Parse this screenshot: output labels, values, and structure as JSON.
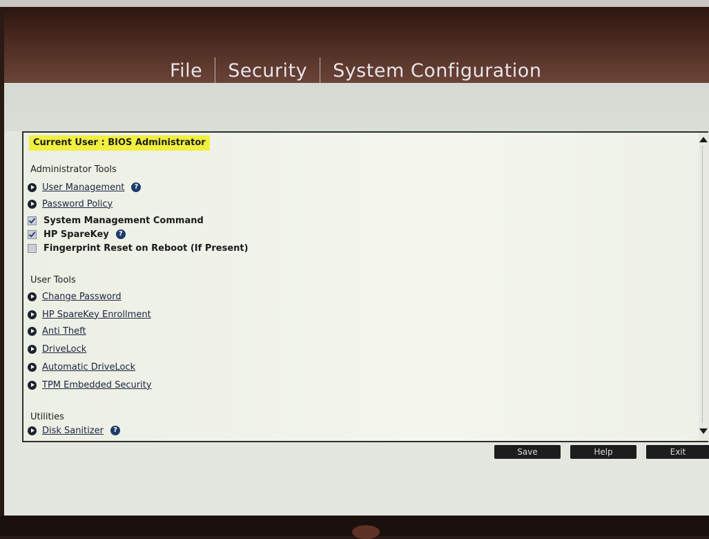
{
  "menu": {
    "items": [
      "File",
      "Security",
      "System Configuration"
    ]
  },
  "header": {
    "current_user": "Current User : BIOS Administrator"
  },
  "admin_tools": {
    "title": "Administrator Tools",
    "user_management": "User Management",
    "password_policy": "Password Policy",
    "system_management_command": "System Management Command",
    "hp_sparekey": "HP SpareKey",
    "fingerprint_reset": "Fingerprint Reset on Reboot (If Present)"
  },
  "user_tools": {
    "title": "User Tools",
    "change_password": "Change Password",
    "sparekey_enrollment": "HP SpareKey Enrollment",
    "anti_theft": "Anti Theft",
    "drivelock": "DriveLock",
    "automatic_drivelock": "Automatic DriveLock",
    "tpm": "TPM Embedded Security"
  },
  "utilities": {
    "title": "Utilities",
    "disk_sanitizer": "Disk Sanitizer"
  },
  "buttons": {
    "save": "Save",
    "help": "Help",
    "exit": "Exit"
  },
  "checkboxes": {
    "system_management_command": true,
    "hp_sparekey": true,
    "fingerprint_reset": false
  },
  "colors": {
    "highlight": "#f1ef3f",
    "menubar": "#3b2018",
    "panel": "#f0f3ea"
  },
  "icons": [
    "chevron-right-icon",
    "help-icon",
    "check-icon",
    "scroll-up-icon",
    "scroll-down-icon"
  ]
}
